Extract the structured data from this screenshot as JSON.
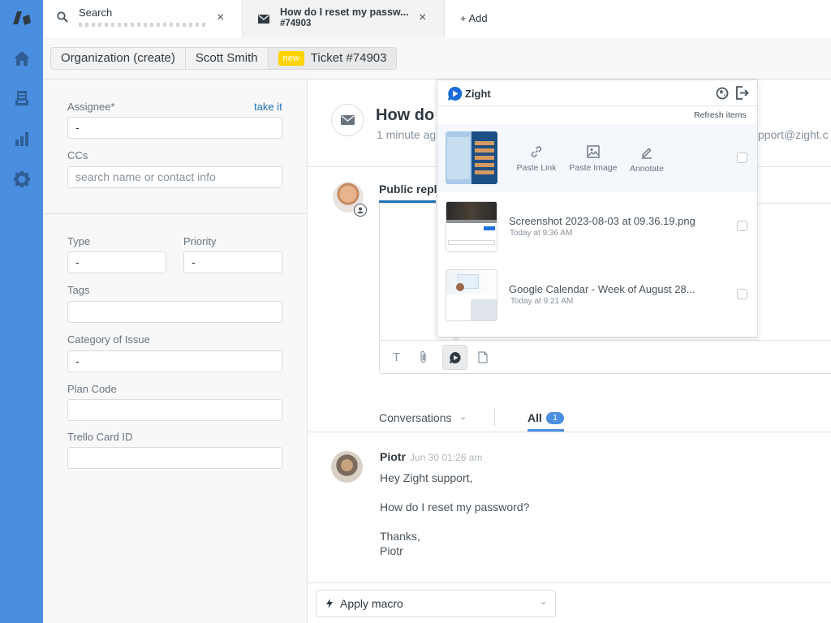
{
  "nav": {
    "logo": "zendesk-logo-icon",
    "items": [
      {
        "name": "home",
        "icon": "home-icon"
      },
      {
        "name": "views",
        "icon": "inbox-icon"
      },
      {
        "name": "reporting",
        "icon": "bar-chart-icon"
      },
      {
        "name": "admin",
        "icon": "gear-icon"
      }
    ]
  },
  "tabs": [
    {
      "label": "Search",
      "sublabel": "",
      "icon": "search-icon"
    },
    {
      "label": "How do I reset my passw...",
      "sublabel": "#74903",
      "icon": "envelope-icon"
    }
  ],
  "add_tab_label": "+ Add",
  "breadcrumbs": [
    {
      "label": "Organization (create)"
    },
    {
      "label": "Scott Smith"
    },
    {
      "label": "Ticket #74903",
      "badge": "new"
    }
  ],
  "fields": {
    "assignee": {
      "label": "Assignee*",
      "value": "-",
      "action": "take it"
    },
    "ccs": {
      "label": "CCs",
      "placeholder": "search name or contact info"
    },
    "type": {
      "label": "Type",
      "value": "-"
    },
    "priority": {
      "label": "Priority",
      "value": "-"
    },
    "tags": {
      "label": "Tags",
      "value": ""
    },
    "category": {
      "label": "Category of Issue",
      "value": "-"
    },
    "plan_code": {
      "label": "Plan Code",
      "value": ""
    },
    "trello": {
      "label": "Trello Card ID",
      "value": ""
    }
  },
  "ticket": {
    "title": "How do",
    "meta": "1 minute ag",
    "via_email": "pport@zight.c"
  },
  "reply": {
    "tab_label": "Public repl"
  },
  "zight": {
    "brand": "Zight",
    "refresh_label": "Refresh items",
    "actions": [
      {
        "label": "Paste Link",
        "icon": "link-icon"
      },
      {
        "label": "Paste Image",
        "icon": "image-icon"
      },
      {
        "label": "Annotate",
        "icon": "pencil-icon"
      }
    ],
    "items": [
      {
        "title": "Screenshot 2023-08-03 at 09.36.19.png",
        "time": "Today at 9:36 AM"
      },
      {
        "title": "Google Calendar - Week of August 28...",
        "time": "Today at 9:21 AM"
      }
    ]
  },
  "composer_tools": [
    {
      "name": "text-format",
      "icon": "text-icon"
    },
    {
      "name": "attachment",
      "icon": "paperclip-icon"
    },
    {
      "name": "zight",
      "icon": "zight-icon"
    },
    {
      "name": "document",
      "icon": "document-icon"
    }
  ],
  "conversations": {
    "filter_label": "Conversations",
    "all_label": "All",
    "all_count": "1"
  },
  "message": {
    "author": "Piotr",
    "time": "Jun 30 01:26 am",
    "lines": [
      "Hey Zight support,",
      "How do I reset my password?",
      "Thanks,",
      "Piotr"
    ]
  },
  "macro": {
    "label": "Apply macro"
  },
  "colors": {
    "nav": "#4a8ee0",
    "accent": "#1f73b7",
    "badge_new": "#ffd400",
    "link": "#1f73b7"
  }
}
